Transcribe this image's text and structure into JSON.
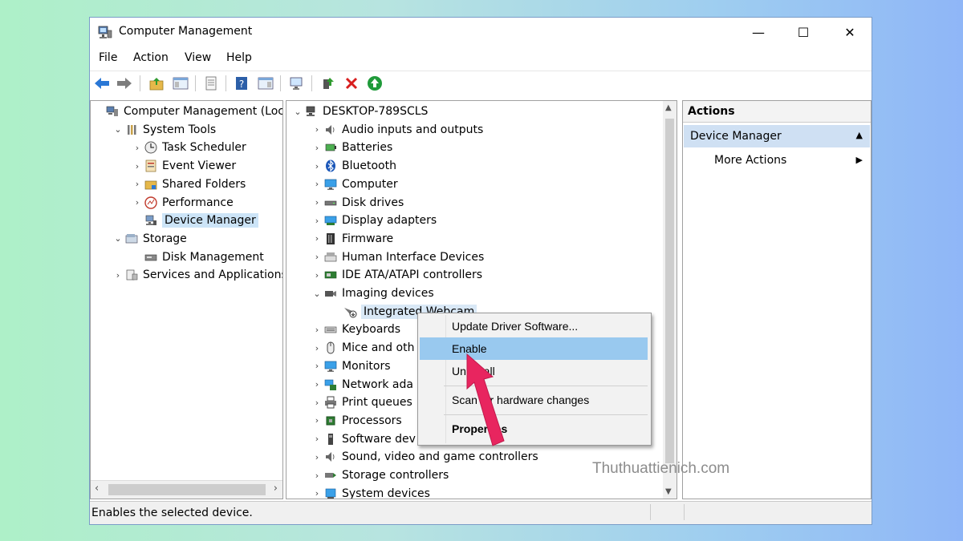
{
  "window": {
    "title": "Computer Management",
    "controls": [
      "—",
      "☐",
      "✕"
    ]
  },
  "menus": [
    "File",
    "Action",
    "View",
    "Help"
  ],
  "left_tree": [
    {
      "label": "Computer Management (Local",
      "expander": "",
      "icon": "computer-management-icon",
      "level": 0,
      "selected": false
    },
    {
      "label": "System Tools",
      "expander": "⌄",
      "icon": "tools-icon",
      "level": 1,
      "selected": false
    },
    {
      "label": "Task Scheduler",
      "expander": "›",
      "icon": "clock-icon",
      "level": 2,
      "selected": false
    },
    {
      "label": "Event Viewer",
      "expander": "›",
      "icon": "event-viewer-icon",
      "level": 2,
      "selected": false
    },
    {
      "label": "Shared Folders",
      "expander": "›",
      "icon": "shared-folders-icon",
      "level": 2,
      "selected": false
    },
    {
      "label": "Performance",
      "expander": "›",
      "icon": "performance-icon",
      "level": 2,
      "selected": false
    },
    {
      "label": "Device Manager",
      "expander": "",
      "icon": "device-manager-icon",
      "level": 2,
      "selected": true
    },
    {
      "label": "Storage",
      "expander": "⌄",
      "icon": "storage-icon",
      "level": 1,
      "selected": false
    },
    {
      "label": "Disk Management",
      "expander": "",
      "icon": "disk-management-icon",
      "level": 2,
      "selected": false
    },
    {
      "label": "Services and Applications",
      "expander": "›",
      "icon": "services-icon",
      "level": 1,
      "selected": false
    }
  ],
  "device_tree": [
    {
      "label": "DESKTOP-789SCLS",
      "expander": "⌄",
      "icon": "computer-root-icon",
      "level": 0
    },
    {
      "label": "Audio inputs and outputs",
      "expander": "›",
      "icon": "speaker-icon",
      "level": 1
    },
    {
      "label": "Batteries",
      "expander": "›",
      "icon": "battery-icon",
      "level": 1
    },
    {
      "label": "Bluetooth",
      "expander": "›",
      "icon": "bluetooth-icon",
      "level": 1
    },
    {
      "label": "Computer",
      "expander": "›",
      "icon": "monitor-icon",
      "level": 1
    },
    {
      "label": "Disk drives",
      "expander": "›",
      "icon": "disk-drive-icon",
      "level": 1
    },
    {
      "label": "Display adapters",
      "expander": "›",
      "icon": "display-adapter-icon",
      "level": 1
    },
    {
      "label": "Firmware",
      "expander": "›",
      "icon": "firmware-icon",
      "level": 1
    },
    {
      "label": "Human Interface Devices",
      "expander": "›",
      "icon": "hid-icon",
      "level": 1
    },
    {
      "label": "IDE ATA/ATAPI controllers",
      "expander": "›",
      "icon": "ide-controller-icon",
      "level": 1
    },
    {
      "label": "Imaging devices",
      "expander": "⌄",
      "icon": "camera-icon",
      "level": 1
    },
    {
      "label": "Integrated Webcam",
      "expander": "",
      "icon": "webcam-disabled-icon",
      "level": 2
    },
    {
      "label": "Keyboards",
      "expander": "›",
      "icon": "keyboard-icon",
      "level": 1
    },
    {
      "label": "Mice and oth",
      "expander": "›",
      "icon": "mouse-icon",
      "level": 1
    },
    {
      "label": "Monitors",
      "expander": "›",
      "icon": "monitor-icon",
      "level": 1
    },
    {
      "label": "Network ada",
      "expander": "›",
      "icon": "network-icon",
      "level": 1
    },
    {
      "label": "Print queues",
      "expander": "›",
      "icon": "printer-icon",
      "level": 1
    },
    {
      "label": "Processors",
      "expander": "›",
      "icon": "processor-icon",
      "level": 1
    },
    {
      "label": "Software dev",
      "expander": "›",
      "icon": "software-device-icon",
      "level": 1
    },
    {
      "label": "Sound, video and game controllers",
      "expander": "›",
      "icon": "speaker-icon",
      "level": 1
    },
    {
      "label": "Storage controllers",
      "expander": "›",
      "icon": "storage-controller-icon",
      "level": 1
    },
    {
      "label": "System devices",
      "expander": "›",
      "icon": "system-device-icon",
      "level": 1
    }
  ],
  "actions": {
    "header": "Actions",
    "section": "Device Manager",
    "more_actions": "More Actions"
  },
  "context_menu": {
    "update": "Update Driver Software...",
    "enable": "Enable",
    "uninstall": "Uninstall",
    "scan": "Scan for hardware changes",
    "properties": "Properties"
  },
  "status": "Enables the selected device.",
  "watermark": "Thuthuattienich.com",
  "colors": {
    "selection": "#cce4f7",
    "highlight": "#99c9ef",
    "arrow": "#e8255f"
  }
}
